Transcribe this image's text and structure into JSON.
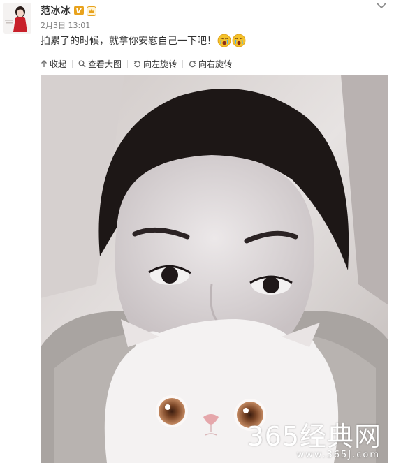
{
  "user": {
    "name": "范冰冰",
    "verified_badge": "V",
    "level_icon": "vip-crown-icon"
  },
  "post": {
    "timestamp": "2月3日 13:01",
    "text": "拍累了的时候，就拿你安慰自己一下吧！",
    "emojis": [
      "crying-face-emoji",
      "crying-face-emoji"
    ]
  },
  "actions": [
    {
      "icon": "collapse-arrow-icon",
      "label": "收起"
    },
    {
      "icon": "magnifier-icon",
      "label": "查看大图"
    },
    {
      "icon": "rotate-left-icon",
      "label": "向左旋转"
    },
    {
      "icon": "rotate-right-icon",
      "label": "向右旋转"
    }
  ],
  "watermark": {
    "main": "365经典网",
    "url": "www.365J.com"
  },
  "colors": {
    "text": "#333333",
    "timestamp": "#808080",
    "verified": "#e8a21c",
    "emoji": "#f5c22b"
  }
}
